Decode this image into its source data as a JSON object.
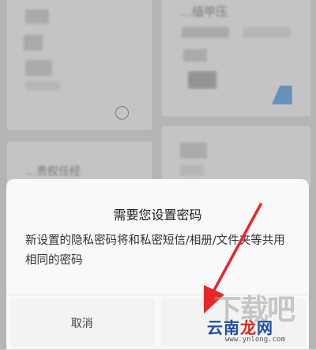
{
  "background": {
    "left_card_text": "…",
    "right_card_text": "…缅甲压",
    "left_bottom_text": "…责权任经"
  },
  "dialog": {
    "title": "需要您设置密码",
    "message": "新设置的隐私密码将和私密短信/相册/文件夹等共用相同的密码",
    "cancel_label": "取消",
    "confirm_label": ""
  },
  "watermark": {
    "brand_cn": "云南龙网",
    "url": "www.ynlong.com",
    "faded_text": "下载吧"
  },
  "colors": {
    "annotation_arrow": "#e8262a",
    "watermark_blue": "#1d4fa3",
    "watermark_red": "#d8261e"
  }
}
